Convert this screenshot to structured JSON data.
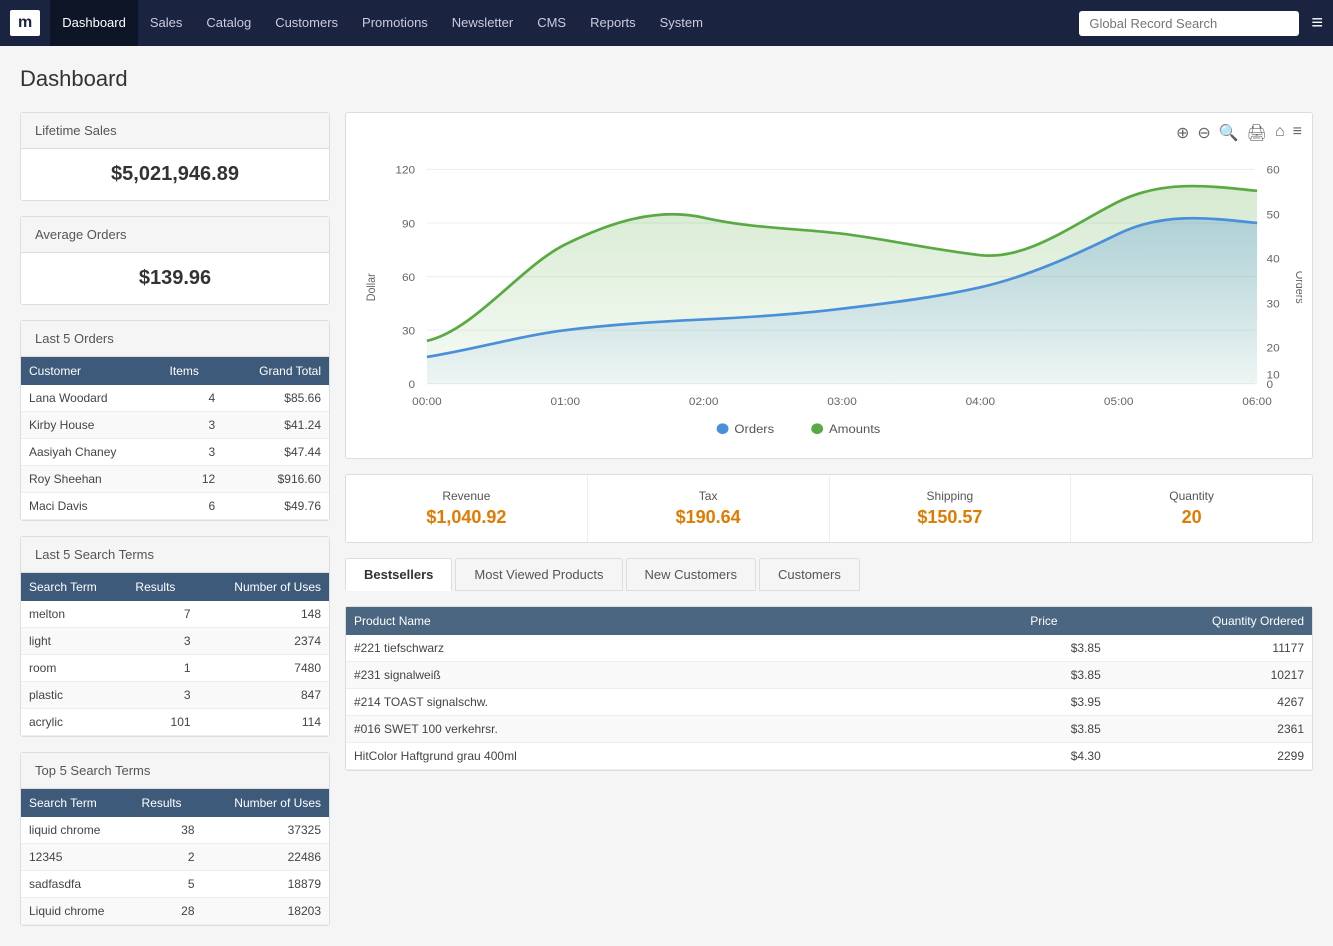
{
  "nav": {
    "logo": "m",
    "items": [
      {
        "label": "Dashboard",
        "active": true
      },
      {
        "label": "Sales",
        "active": false
      },
      {
        "label": "Catalog",
        "active": false
      },
      {
        "label": "Customers",
        "active": false
      },
      {
        "label": "Promotions",
        "active": false
      },
      {
        "label": "Newsletter",
        "active": false
      },
      {
        "label": "CMS",
        "active": false
      },
      {
        "label": "Reports",
        "active": false
      },
      {
        "label": "System",
        "active": false
      }
    ],
    "search_placeholder": "Global Record Search"
  },
  "page": {
    "title": "Dashboard"
  },
  "lifetime_sales": {
    "label": "Lifetime Sales",
    "value": "$5,021,946.89"
  },
  "average_orders": {
    "label": "Average Orders",
    "value": "$139.96"
  },
  "last5orders": {
    "label": "Last 5 Orders",
    "headers": [
      "Customer",
      "Items",
      "Grand Total"
    ],
    "rows": [
      {
        "customer": "Lana Woodard",
        "items": "4",
        "total": "$85.66"
      },
      {
        "customer": "Kirby House",
        "items": "3",
        "total": "$41.24"
      },
      {
        "customer": "Aasiyah Chaney",
        "items": "3",
        "total": "$47.44"
      },
      {
        "customer": "Roy Sheehan",
        "items": "12",
        "total": "$916.60"
      },
      {
        "customer": "Maci Davis",
        "items": "6",
        "total": "$49.76"
      }
    ]
  },
  "last5search": {
    "label": "Last 5 Search Terms",
    "headers": [
      "Search Term",
      "Results",
      "Number of Uses"
    ],
    "rows": [
      {
        "term": "melton",
        "results": "7",
        "uses": "148"
      },
      {
        "term": "light",
        "results": "3",
        "uses": "2374"
      },
      {
        "term": "room",
        "results": "1",
        "uses": "7480"
      },
      {
        "term": "plastic",
        "results": "3",
        "uses": "847"
      },
      {
        "term": "acrylic",
        "results": "101",
        "uses": "114"
      }
    ]
  },
  "top5search": {
    "label": "Top 5 Search Terms",
    "headers": [
      "Search Term",
      "Results",
      "Number of Uses"
    ],
    "rows": [
      {
        "term": "liquid chrome",
        "results": "38",
        "uses": "37325"
      },
      {
        "term": "12345",
        "results": "2",
        "uses": "22486"
      },
      {
        "term": "sadfasdfa",
        "results": "5",
        "uses": "18879"
      },
      {
        "term": "Liquid chrome",
        "results": "28",
        "uses": "18203"
      }
    ]
  },
  "stats": {
    "revenue_label": "Revenue",
    "revenue_value": "$1,040.92",
    "tax_label": "Tax",
    "tax_value": "$190.64",
    "shipping_label": "Shipping",
    "shipping_value": "$150.57",
    "quantity_label": "Quantity",
    "quantity_value": "20"
  },
  "tabs": [
    {
      "label": "Bestsellers",
      "active": true
    },
    {
      "label": "Most Viewed Products",
      "active": false
    },
    {
      "label": "New Customers",
      "active": false
    },
    {
      "label": "Customers",
      "active": false
    }
  ],
  "bestsellers": {
    "headers": [
      "Product Name",
      "Price",
      "Quantity Ordered"
    ],
    "rows": [
      {
        "name": "#221 tiefschwarz",
        "price": "$3.85",
        "qty": "11177"
      },
      {
        "name": "#231 signalweiß",
        "price": "$3.85",
        "qty": "10217"
      },
      {
        "name": "#214 TOAST signalschw.",
        "price": "$3.95",
        "qty": "4267"
      },
      {
        "name": "#016 SWET 100 verkehrsr.",
        "price": "$3.85",
        "qty": "2361"
      },
      {
        "name": "HitColor Haftgrund grau 400ml",
        "price": "$4.30",
        "qty": "2299"
      }
    ]
  },
  "chart": {
    "x_labels": [
      "00:00",
      "01:00",
      "02:00",
      "03:00",
      "04:00",
      "05:00",
      "06:00"
    ],
    "y_left_labels": [
      "0",
      "30",
      "60",
      "90",
      "120"
    ],
    "y_right_labels": [
      "0",
      "10",
      "20",
      "30",
      "40",
      "50",
      "60"
    ],
    "legend": [
      {
        "label": "Orders",
        "color": "#4a90d9"
      },
      {
        "label": "Amounts",
        "color": "#5aaa44"
      }
    ]
  },
  "chart_toolbar": {
    "zoom_in": "+",
    "zoom_out": "−",
    "magnify": "🔍",
    "print": "🖨",
    "home": "⌂",
    "menu": "≡"
  }
}
